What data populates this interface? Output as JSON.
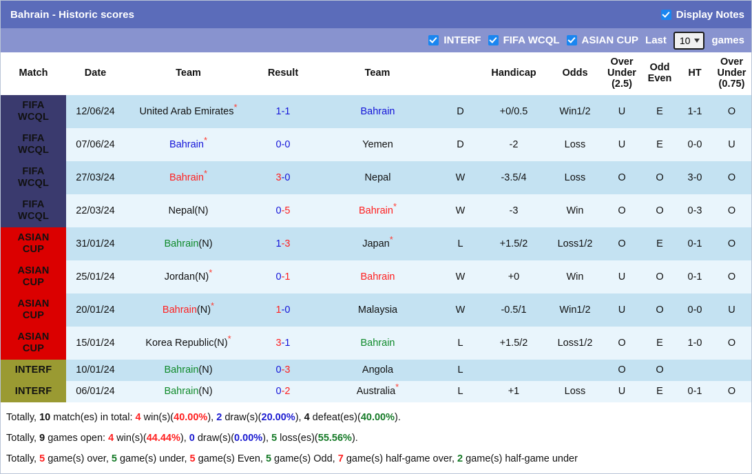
{
  "titlebar": {
    "title": "Bahrain - Historic scores",
    "display_notes_label": "Display Notes",
    "display_notes_checked": true
  },
  "filterbar": {
    "filters": [
      {
        "label": "INTERF",
        "checked": true
      },
      {
        "label": "FIFA WCQL",
        "checked": true
      },
      {
        "label": "ASIAN CUP",
        "checked": true
      }
    ],
    "last_label": "Last",
    "games_count": "10",
    "games_label": "games"
  },
  "table": {
    "headers": {
      "match": "Match",
      "date": "Date",
      "team1": "Team",
      "result": "Result",
      "team2": "Team",
      "handicap": "Handicap",
      "odds": "Odds",
      "over_under_25": "Over\nUnder\n(2.5)",
      "over_under_25_l1": "Over",
      "over_under_25_l2": "Under",
      "over_under_25_l3": "(2.5)",
      "odd_even_l1": "Odd",
      "odd_even_l2": "Even",
      "ht": "HT",
      "over_under_075_l1": "Over",
      "over_under_075_l2": "Under",
      "over_under_075_l3": "(0.75)"
    },
    "rows": [
      {
        "comp": "FIFA WCQL",
        "comp_class": "fifa",
        "date": "12/06/24",
        "home": "United Arab Emirates",
        "home_suffix": "",
        "home_star": true,
        "home_color": "blk",
        "score_h": "1",
        "score_sep": "-",
        "score_a": "1",
        "score_h_color": "blue",
        "score_a_color": "blue",
        "away": "Bahrain",
        "away_suffix": "",
        "away_star": false,
        "away_color": "blue",
        "result": "D",
        "result_color": "blue",
        "handicap": "+0/0.5",
        "odds": "Win1/2",
        "odds_color": "red",
        "ou25": "U",
        "ou25_color": "green",
        "oddeven": "E",
        "oddeven_color": "red",
        "ht": "1-1",
        "ou075": "O",
        "ou075_color": "red"
      },
      {
        "comp": "FIFA WCQL",
        "comp_class": "fifa",
        "date": "07/06/24",
        "home": "Bahrain",
        "home_suffix": "",
        "home_star": true,
        "home_color": "blue",
        "score_h": "0",
        "score_sep": "-",
        "score_a": "0",
        "score_h_color": "blue",
        "score_a_color": "blue",
        "away": "Yemen",
        "away_suffix": "",
        "away_star": false,
        "away_color": "blk",
        "result": "D",
        "result_color": "blue",
        "handicap": "-2",
        "odds": "Loss",
        "odds_color": "green",
        "ou25": "U",
        "ou25_color": "green",
        "oddeven": "E",
        "oddeven_color": "red",
        "ht": "0-0",
        "ou075": "U",
        "ou075_color": "green"
      },
      {
        "comp": "FIFA WCQL",
        "comp_class": "fifa",
        "date": "27/03/24",
        "home": "Bahrain",
        "home_suffix": "",
        "home_star": true,
        "home_color": "red",
        "score_h": "3",
        "score_sep": "-",
        "score_a": "0",
        "score_h_color": "red",
        "score_a_color": "blue",
        "away": "Nepal",
        "away_suffix": "",
        "away_star": false,
        "away_color": "blk",
        "result": "W",
        "result_color": "red",
        "handicap": "-3.5/4",
        "odds": "Loss",
        "odds_color": "green",
        "ou25": "O",
        "ou25_color": "red",
        "oddeven": "O",
        "oddeven_color": "green",
        "ht": "3-0",
        "ou075": "O",
        "ou075_color": "red"
      },
      {
        "comp": "FIFA WCQL",
        "comp_class": "fifa",
        "date": "22/03/24",
        "home": "Nepal",
        "home_suffix": "(N)",
        "home_star": false,
        "home_color": "blk",
        "score_h": "0",
        "score_sep": "-",
        "score_a": "5",
        "score_h_color": "blue",
        "score_a_color": "red",
        "away": "Bahrain",
        "away_suffix": "",
        "away_star": true,
        "away_color": "red",
        "result": "W",
        "result_color": "red",
        "handicap": "-3",
        "odds": "Win",
        "odds_color": "red",
        "ou25": "O",
        "ou25_color": "red",
        "oddeven": "O",
        "oddeven_color": "green",
        "ht": "0-3",
        "ou075": "O",
        "ou075_color": "red"
      },
      {
        "comp": "ASIAN CUP",
        "comp_class": "asian",
        "date": "31/01/24",
        "home": "Bahrain",
        "home_suffix": "(N)",
        "home_star": false,
        "home_color": "green",
        "score_h": "1",
        "score_sep": "-",
        "score_a": "3",
        "score_h_color": "blue",
        "score_a_color": "red",
        "away": "Japan",
        "away_suffix": "",
        "away_star": true,
        "away_color": "blk",
        "result": "L",
        "result_color": "green",
        "handicap": "+1.5/2",
        "odds": "Loss1/2",
        "odds_color": "green",
        "ou25": "O",
        "ou25_color": "red",
        "oddeven": "E",
        "oddeven_color": "red",
        "ht": "0-1",
        "ou075": "O",
        "ou075_color": "red"
      },
      {
        "comp": "ASIAN CUP",
        "comp_class": "asian",
        "date": "25/01/24",
        "home": "Jordan",
        "home_suffix": "(N)",
        "home_star": true,
        "home_color": "blk",
        "score_h": "0",
        "score_sep": "-",
        "score_a": "1",
        "score_h_color": "blue",
        "score_a_color": "red",
        "away": "Bahrain",
        "away_suffix": "",
        "away_star": false,
        "away_color": "red",
        "result": "W",
        "result_color": "red",
        "handicap": "+0",
        "odds": "Win",
        "odds_color": "red",
        "ou25": "U",
        "ou25_color": "green",
        "oddeven": "O",
        "oddeven_color": "green",
        "ht": "0-1",
        "ou075": "O",
        "ou075_color": "red"
      },
      {
        "comp": "ASIAN CUP",
        "comp_class": "asian",
        "date": "20/01/24",
        "home": "Bahrain",
        "home_suffix": "(N)",
        "home_star": true,
        "home_color": "red",
        "score_h": "1",
        "score_sep": "-",
        "score_a": "0",
        "score_h_color": "red",
        "score_a_color": "blue",
        "away": "Malaysia",
        "away_suffix": "",
        "away_star": false,
        "away_color": "blk",
        "result": "W",
        "result_color": "red",
        "handicap": "-0.5/1",
        "odds": "Win1/2",
        "odds_color": "red",
        "ou25": "U",
        "ou25_color": "green",
        "oddeven": "O",
        "oddeven_color": "green",
        "ht": "0-0",
        "ou075": "U",
        "ou075_color": "green"
      },
      {
        "comp": "ASIAN CUP",
        "comp_class": "asian",
        "date": "15/01/24",
        "home": "Korea Republic",
        "home_suffix": "(N)",
        "home_star": true,
        "home_color": "blk",
        "score_h": "3",
        "score_sep": "-",
        "score_a": "1",
        "score_h_color": "red",
        "score_a_color": "blue",
        "away": "Bahrain",
        "away_suffix": "",
        "away_star": false,
        "away_color": "green",
        "result": "L",
        "result_color": "green",
        "handicap": "+1.5/2",
        "odds": "Loss1/2",
        "odds_color": "green",
        "ou25": "O",
        "ou25_color": "red",
        "oddeven": "E",
        "oddeven_color": "red",
        "ht": "1-0",
        "ou075": "O",
        "ou075_color": "red"
      },
      {
        "comp": "INTERF",
        "comp_class": "interf",
        "date": "10/01/24",
        "home": "Bahrain",
        "home_suffix": "(N)",
        "home_star": false,
        "home_color": "green",
        "score_h": "0",
        "score_sep": "-",
        "score_a": "3",
        "score_h_color": "blue",
        "score_a_color": "red",
        "away": "Angola",
        "away_suffix": "",
        "away_star": false,
        "away_color": "blk",
        "result": "L",
        "result_color": "green",
        "handicap": "",
        "odds": "",
        "odds_color": "green",
        "ou25": "O",
        "ou25_color": "red",
        "oddeven": "O",
        "oddeven_color": "green",
        "ht": "",
        "ou075": "",
        "ou075_color": "red"
      },
      {
        "comp": "INTERF",
        "comp_class": "interf",
        "date": "06/01/24",
        "home": "Bahrain",
        "home_suffix": "(N)",
        "home_star": false,
        "home_color": "green",
        "score_h": "0",
        "score_sep": "-",
        "score_a": "2",
        "score_h_color": "blue",
        "score_a_color": "red",
        "away": "Australia",
        "away_suffix": "",
        "away_star": true,
        "away_color": "blk",
        "result": "L",
        "result_color": "green",
        "handicap": "+1",
        "odds": "Loss",
        "odds_color": "green",
        "ou25": "U",
        "ou25_color": "green",
        "oddeven": "E",
        "oddeven_color": "red",
        "ht": "0-1",
        "ou075": "O",
        "ou075_color": "red"
      }
    ]
  },
  "footer": {
    "line1": {
      "p1": "Totally, ",
      "total": "10",
      "p2": " match(es) in total: ",
      "wins": "4",
      "p3": " win(s)(",
      "win_pct": "40.00%",
      "p4": "), ",
      "draws": "2",
      "p5": " draw(s)(",
      "draw_pct": "20.00%",
      "p6": "), ",
      "defeats": "4",
      "p7": " defeat(es)(",
      "defeat_pct": "40.00%",
      "p8": ")."
    },
    "line2": {
      "p1": "Totally, ",
      "open": "9",
      "p2": " games open: ",
      "wins": "4",
      "p3": " win(s)(",
      "win_pct": "44.44%",
      "p4": "), ",
      "draws": "0",
      "p5": " draw(s)(",
      "draw_pct": "0.00%",
      "p6": "), ",
      "losses": "5",
      "p7": " loss(es)(",
      "loss_pct": "55.56%",
      "p8": ")."
    },
    "line3": {
      "p1": "Totally, ",
      "over": "5",
      "p2": " game(s) over, ",
      "under": "5",
      "p3": " game(s) under, ",
      "even": "5",
      "p4": " game(s) Even, ",
      "odd": "5",
      "p5": " game(s) Odd, ",
      "half_over": "7",
      "p6": " game(s) half-game over, ",
      "half_under": "2",
      "p7": " game(s) half-game under"
    }
  },
  "colors": {
    "titlebar_bg": "#5b6cba",
    "filterbar_bg": "#8893cf",
    "fifa_badge": "#3a3a6e",
    "asian_badge": "#db0000",
    "interf_badge": "#9a9a32",
    "row_odd": "#c4e2f2",
    "row_even": "#e9f5fc",
    "red": "#ff2020",
    "blue": "#1414d8",
    "green": "#0f8a2a"
  }
}
